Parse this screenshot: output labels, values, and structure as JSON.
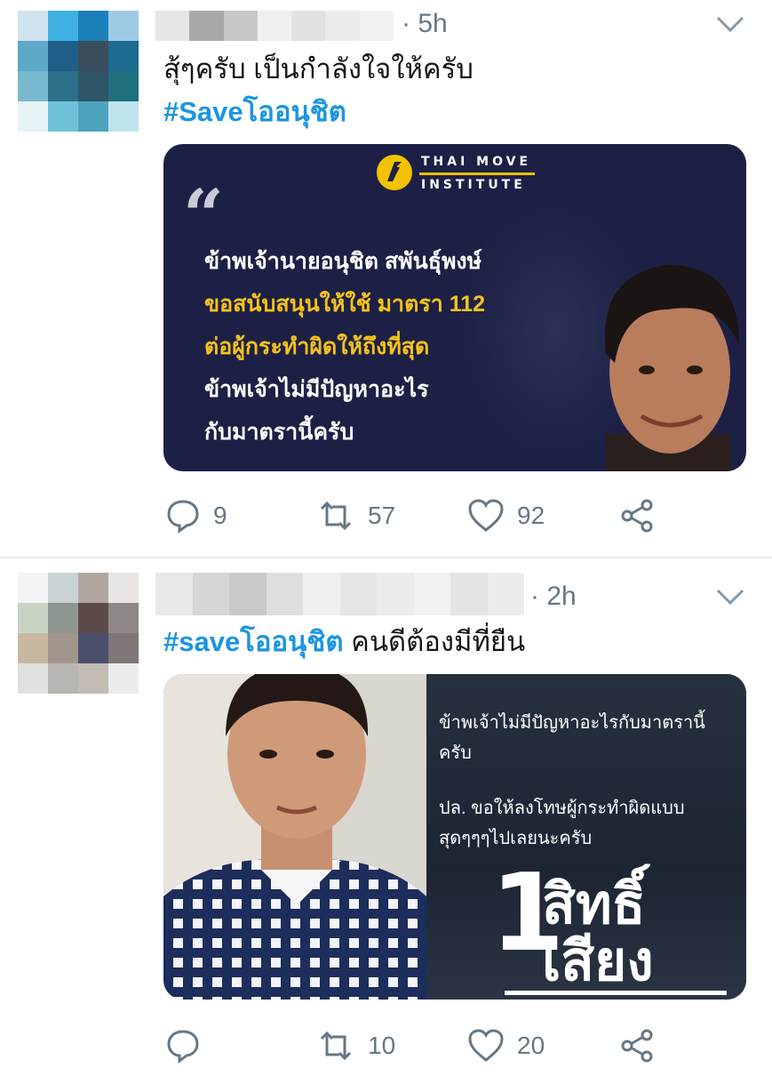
{
  "tweets": [
    {
      "time": "· 5h",
      "text_lines": [
        "สุ้ๆครับ เป็นกำลังใจให้ครับ"
      ],
      "hashtag": "#Saveโออนุชิต",
      "media": {
        "logo_line1": "THAI MOVE",
        "logo_line2": "INSTITUTE",
        "quote_mark": "“",
        "lines": [
          "ข้าพเจ้านายอนุชิต สพันธุ์พงษ์",
          "ขอสนับสนุนให้ใช้ มาตรา 112",
          "ต่อผู้กระทำผิดให้ถึงที่สุด",
          "ข้าพเจ้าไม่มีปัญหาอะไร",
          "กับมาตรานี้ครับ"
        ]
      },
      "actions": {
        "replies": "9",
        "retweets": "57",
        "likes": "92"
      }
    },
    {
      "time": "· 2h",
      "hashtag": "#saveโออนุชิต",
      "text_after": " คนดีต้องมีที่ยืน",
      "media": {
        "lines": [
          "ข้าพเจ้าไม่มีปัญหาอะไรกับมาตรานี้",
          "ครับ",
          "ปล. ขอให้ลงโทษผู้กระทำผิดแบบ",
          "สุดๆๆๆไปเลยนะครับ"
        ],
        "big_number": "1",
        "big_line1": "สิทธิ์",
        "big_line2": "เสียง"
      },
      "actions": {
        "replies": "",
        "retweets": "10",
        "likes": "20"
      }
    }
  ],
  "colors": {
    "hashtag": "#1b95e0",
    "meta": "#657786",
    "separator": "#e6ecf0"
  }
}
